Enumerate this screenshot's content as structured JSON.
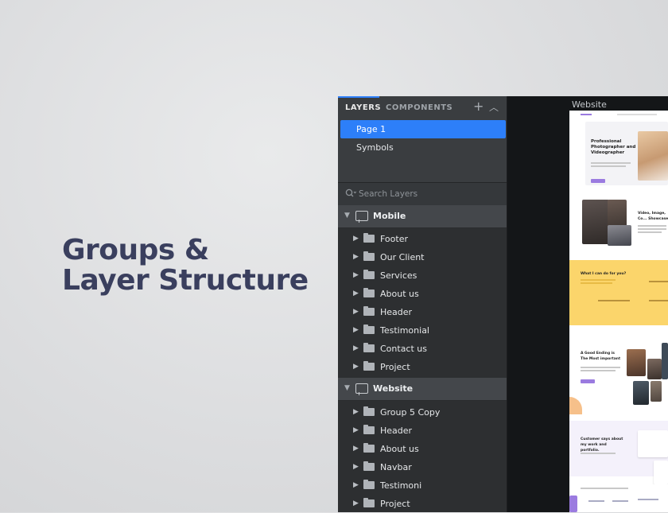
{
  "headline": {
    "line1": "Groups &",
    "line2": "Layer Structure"
  },
  "panel": {
    "tabs": {
      "layers": "LAYERS",
      "components": "COMPONENTS"
    },
    "toolbar": {
      "add_icon": "+",
      "collapse_icon": "^"
    },
    "pages": [
      {
        "label": "Page 1",
        "selected": true
      },
      {
        "label": "Symbols",
        "selected": false
      }
    ],
    "search": {
      "placeholder": "Search Layers",
      "icon": "search-icon"
    },
    "groups": [
      {
        "label": "Mobile",
        "expanded": true,
        "children": [
          "Footer",
          "Our Client",
          "Services",
          "About us",
          "Header",
          "Testimonial",
          "Contact us",
          "Project"
        ]
      },
      {
        "label": "Website",
        "expanded": true,
        "children": [
          "Group 5 Copy",
          "Header",
          "About us",
          "Navbar",
          "Testimoni",
          "Project"
        ]
      }
    ]
  },
  "canvas": {
    "artboard_title": "Website",
    "preview": {
      "hero_title": "Professional Photographer and Videographer",
      "video_title": "Video, Image, Co... Showcase",
      "what_title": "What I can do for you?",
      "good_title": "A Good Ending is The Most important",
      "customer_title": "Customer says about my work and portfolio."
    }
  },
  "colors": {
    "accent": "#2d7ff9",
    "panel_bg": "#2d2f31",
    "headline": "#3a3f5e",
    "preview_yellow": "#fbd56b",
    "preview_purple": "#9b7be0"
  }
}
